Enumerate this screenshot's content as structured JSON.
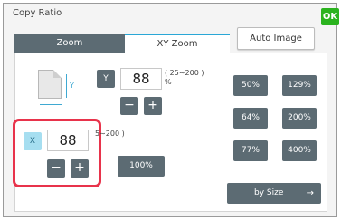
{
  "window": {
    "title": "Copy Ratio",
    "ok_label": "OK"
  },
  "tabs": [
    {
      "label": "Zoom",
      "selected": false
    },
    {
      "label": "XY Zoom",
      "selected": true
    }
  ],
  "auto_image_label": "Auto Image",
  "y_axis": {
    "badge": "Y",
    "value": "88",
    "range": "( 25∼200 )",
    "unit": "%",
    "minus": "−",
    "plus": "+"
  },
  "x_axis": {
    "badge": "X",
    "value": "88",
    "range": "5∼200 )",
    "minus": "−",
    "plus": "+"
  },
  "diagram_label": "Y",
  "btn_100": "100%",
  "presets": [
    {
      "label": "50%"
    },
    {
      "label": "129%"
    },
    {
      "label": "64%"
    },
    {
      "label": "200%"
    },
    {
      "label": "77%"
    },
    {
      "label": "400%"
    }
  ],
  "by_size": {
    "label": "by Size",
    "arrow": "→"
  },
  "colors": {
    "accent_tab": "#2aa7d6",
    "button": "#5c6b73",
    "ok": "#2bb31f",
    "highlight": "#e8334b",
    "x_badge": "#a6def0"
  }
}
